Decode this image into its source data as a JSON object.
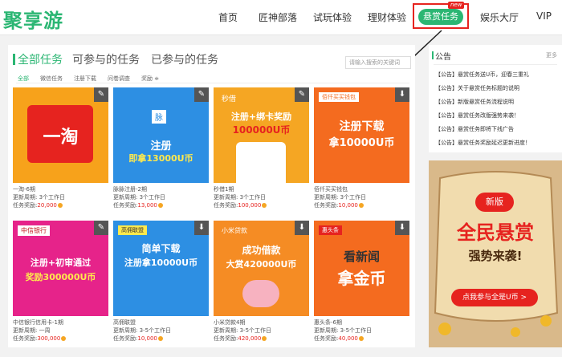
{
  "header": {
    "logo": "聚享游",
    "nav": [
      "首页",
      "匠神部落",
      "试玩体验",
      "理财体验",
      "悬赏任务",
      "娱乐大厅",
      "VIP"
    ],
    "new_badge": "new",
    "colors": {
      "accent": "#2bb673",
      "highlight": "#e6231f"
    }
  },
  "main": {
    "tabs": [
      "全部任务",
      "可参与的任务",
      "已参与的任务"
    ],
    "search_placeholder": "请输入搜索的关键词",
    "filters": [
      "全部",
      "微信任务",
      "注册下载",
      "问卷调查",
      "奖励 ≑"
    ],
    "cards": [
      {
        "thumb_text": "一淘",
        "thumb_sub": "",
        "tag": "",
        "btn": "✎",
        "name": "一淘-6期",
        "cycle": "更新周期: 3个工作日",
        "reward_label": "任务奖励:",
        "reward": "20,000"
      },
      {
        "thumb_text": "注册",
        "thumb_sub": "即拿13000U币",
        "tag": "脉",
        "btn": "✎",
        "name": "脉脉注册-2期",
        "cycle": "更新周期: 3个工作日",
        "reward_label": "任务奖励:",
        "reward": "13,000"
      },
      {
        "thumb_text": "注册+绑卡奖励",
        "thumb_sub": "100000U币",
        "tag": "秒借",
        "btn": "✎",
        "name": "秒借1期",
        "cycle": "更新周期: 3个工作日",
        "reward_label": "任务奖励:",
        "reward": "100,000"
      },
      {
        "thumb_text": "注册下载",
        "thumb_sub": "拿10000U币",
        "tag": "佰仟买买钱包",
        "btn": "⬇",
        "name": "佰仟买买钱包",
        "cycle": "更新周期: 3个工作日",
        "reward_label": "任务奖励:",
        "reward": "10,000"
      },
      {
        "thumb_text": "注册+初审通过",
        "thumb_sub": "奖励300000U币",
        "tag": "中信银行",
        "btn": "✎",
        "name": "中信银行信用卡-1期",
        "cycle": "更新周期: 一周",
        "reward_label": "任务奖励:",
        "reward": "300,000"
      },
      {
        "thumb_text": "简单下载",
        "thumb_sub": "注册拿10000U币",
        "tag": "高佣联盟",
        "btn": "⬇",
        "name": "高佣联盟",
        "cycle": "更新周期: 3-5个工作日",
        "reward_label": "任务奖励:",
        "reward": "10,000"
      },
      {
        "thumb_text": "成功借款",
        "thumb_sub": "大赏420000U币",
        "tag": "小米贷款",
        "btn": "⬇",
        "name": "小米贷款4期",
        "cycle": "更新周期: 3-5个工作日",
        "reward_label": "任务奖励:",
        "reward": "420,000"
      },
      {
        "thumb_text": "看新闻",
        "thumb_sub": "拿金币",
        "tag": "惠头条",
        "btn": "⬇",
        "name": "惠头条-6期",
        "cycle": "更新周期: 3-5个工作日",
        "reward_label": "任务奖励:",
        "reward": "40,000"
      }
    ]
  },
  "side": {
    "title": "公告",
    "more": "更多",
    "notices": [
      "【公告】悬赏任务送U币，迎春三重礼",
      "【公告】关于悬赏任务标题的说明",
      "【公告】新版悬赏任务流程说明",
      "【公告】悬赏任务改版强势来袭！",
      "【公告】悬赏任务即将下线广告",
      "【公告】悬赏任务奖励延迟更新进度！"
    ]
  },
  "banner": {
    "line1": "新版",
    "line2": "全民悬赏",
    "line3": "强势来袭!",
    "button": "点我参与全是U币 >"
  }
}
